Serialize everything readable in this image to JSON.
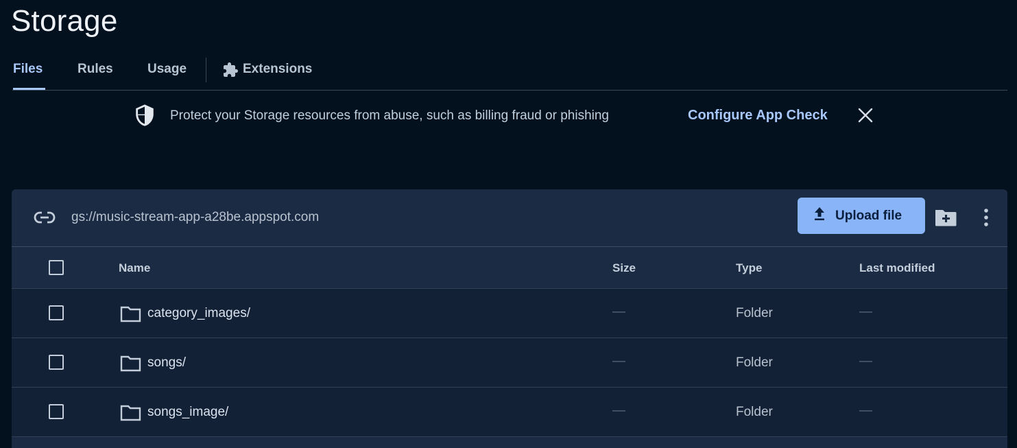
{
  "page": {
    "title": "Storage"
  },
  "tabs": [
    {
      "label": "Files",
      "active": true
    },
    {
      "label": "Rules",
      "active": false
    },
    {
      "label": "Usage",
      "active": false
    },
    {
      "label": "Extensions",
      "active": false,
      "icon": "puzzle-icon"
    }
  ],
  "banner": {
    "icon": "shield-icon",
    "text": "Protect your Storage resources from abuse, such as billing fraud or phishing",
    "link_label": "Configure App Check",
    "close_icon": "close-icon"
  },
  "bucket": {
    "link_icon": "link-icon",
    "url": "gs://music-stream-app-a28be.appspot.com",
    "upload_label": "Upload file",
    "upload_icon": "upload-icon",
    "new_folder_icon": "create-folder-icon",
    "more_icon": "more-vert-icon"
  },
  "table": {
    "columns": {
      "name": "Name",
      "size": "Size",
      "type": "Type",
      "modified": "Last modified"
    },
    "rows": [
      {
        "name": "category_images/",
        "size": "—",
        "type": "Folder",
        "modified": "—"
      },
      {
        "name": "songs/",
        "size": "—",
        "type": "Folder",
        "modified": "—"
      },
      {
        "name": "songs_image/",
        "size": "—",
        "type": "Folder",
        "modified": "—"
      }
    ]
  },
  "colors": {
    "background": "#03111f",
    "panel": "#1b2b44",
    "accent": "#a8c7fa",
    "button": "#8ab4f8"
  }
}
